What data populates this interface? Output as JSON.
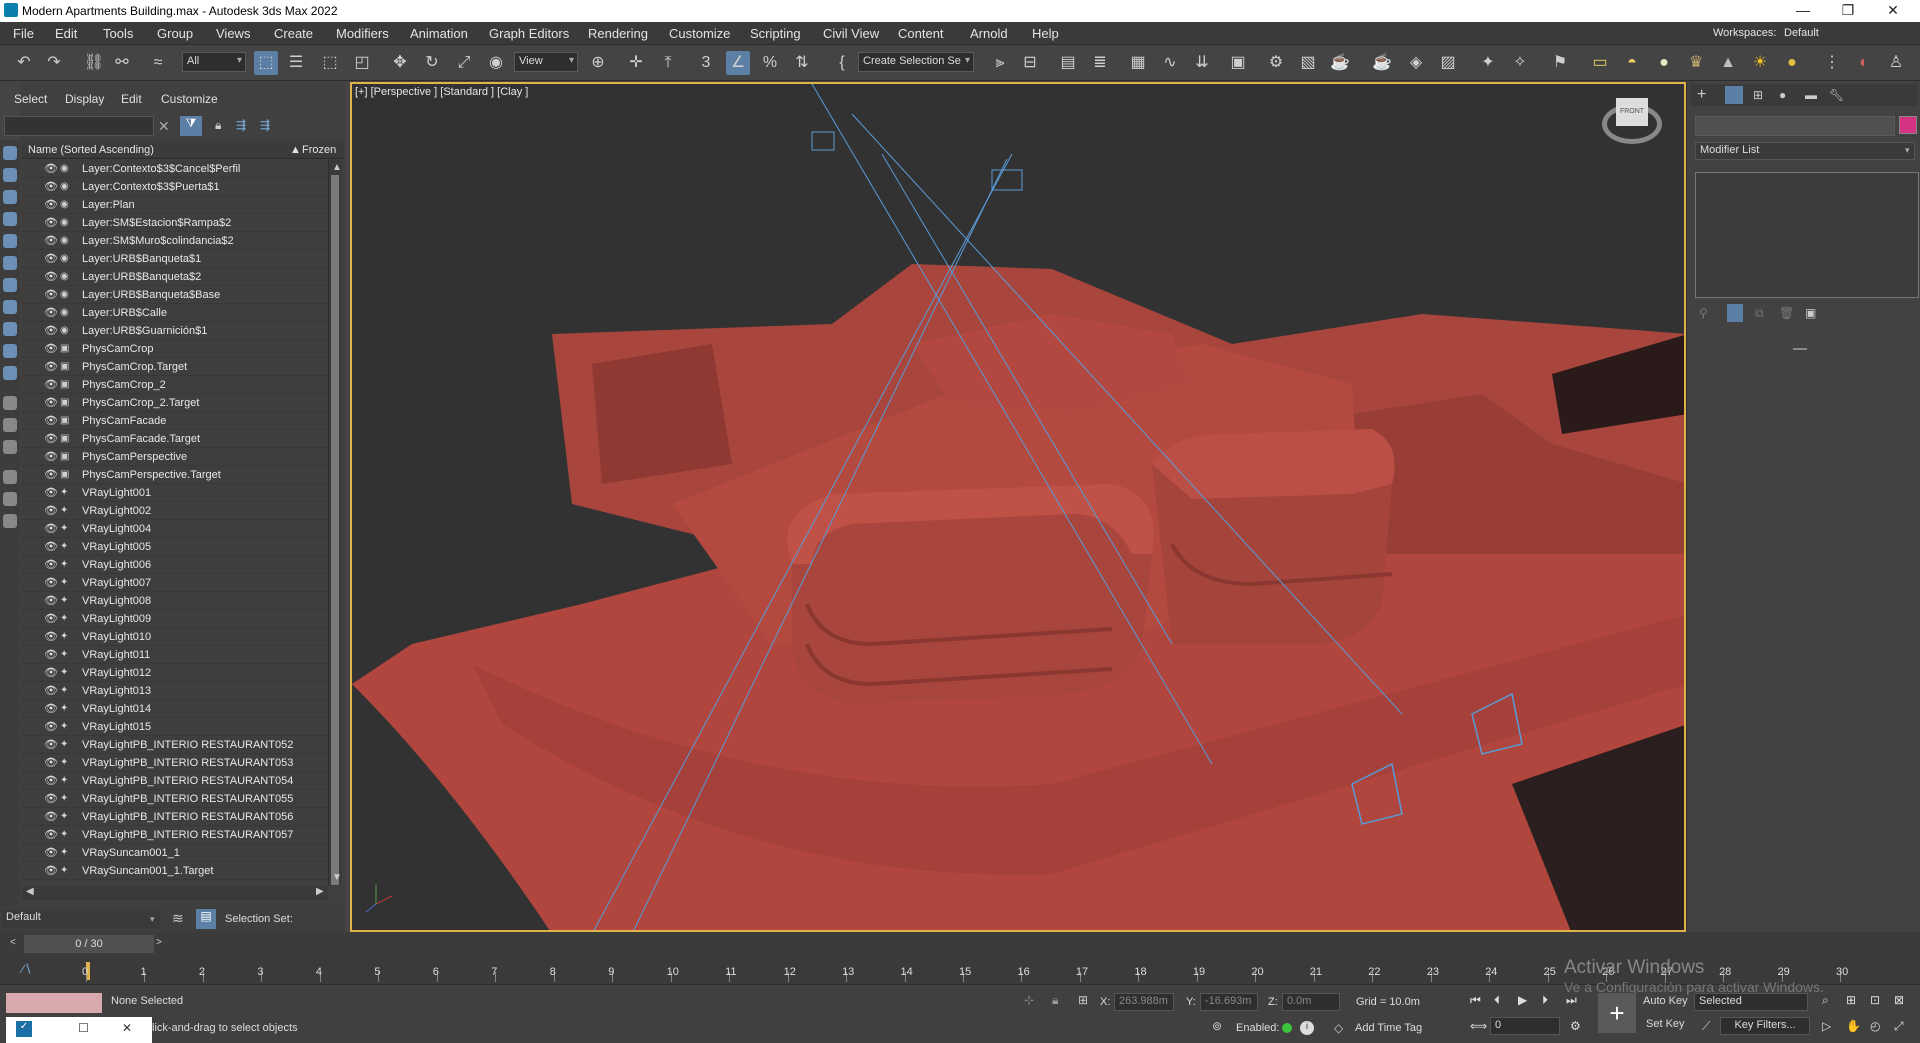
{
  "window": {
    "title": "Modern Apartments Building.max - Autodesk 3ds Max 2022",
    "minimize": "—",
    "maximize": "❐",
    "close": "✕"
  },
  "menu": [
    "File",
    "Edit",
    "Tools",
    "Group",
    "Views",
    "Create",
    "Modifiers",
    "Animation",
    "Graph Editors",
    "Rendering",
    "Customize",
    "Scripting",
    "Civil View",
    "Content",
    "Arnold",
    "Help"
  ],
  "workspace": {
    "label": "Workspaces:",
    "value": "Default"
  },
  "toolbar": {
    "filter_value": "All",
    "view_value": "View",
    "selection_set": "Create Selection Se"
  },
  "explorer": {
    "menu": [
      "Select",
      "Display",
      "Edit",
      "Customize"
    ],
    "col_name": "Name (Sorted Ascending)",
    "col_frozen": "Frozen",
    "rows": [
      {
        "name": "Layer:Contexto$3$Cancel$Perfil",
        "type": "layer"
      },
      {
        "name": "Layer:Contexto$3$Puerta$1",
        "type": "layer"
      },
      {
        "name": "Layer:Plan",
        "type": "layer"
      },
      {
        "name": "Layer:SM$Estacion$Rampa$2",
        "type": "layer"
      },
      {
        "name": "Layer:SM$Muro$colindancia$2",
        "type": "layer"
      },
      {
        "name": "Layer:URB$Banqueta$1",
        "type": "layer"
      },
      {
        "name": "Layer:URB$Banqueta$2",
        "type": "layer"
      },
      {
        "name": "Layer:URB$Banqueta$Base",
        "type": "layer"
      },
      {
        "name": "Layer:URB$Calle",
        "type": "layer"
      },
      {
        "name": "Layer:URB$Guarnición$1",
        "type": "layer"
      },
      {
        "name": "PhysCamCrop",
        "type": "camera"
      },
      {
        "name": "PhysCamCrop.Target",
        "type": "camera"
      },
      {
        "name": "PhysCamCrop_2",
        "type": "camera"
      },
      {
        "name": "PhysCamCrop_2.Target",
        "type": "camera"
      },
      {
        "name": "PhysCamFacade",
        "type": "camera"
      },
      {
        "name": "PhysCamFacade.Target",
        "type": "camera"
      },
      {
        "name": "PhysCamPerspective",
        "type": "camera"
      },
      {
        "name": "PhysCamPerspective.Target",
        "type": "camera"
      },
      {
        "name": "VRayLight001",
        "type": "light"
      },
      {
        "name": "VRayLight002",
        "type": "light"
      },
      {
        "name": "VRayLight004",
        "type": "light"
      },
      {
        "name": "VRayLight005",
        "type": "light"
      },
      {
        "name": "VRayLight006",
        "type": "light"
      },
      {
        "name": "VRayLight007",
        "type": "light"
      },
      {
        "name": "VRayLight008",
        "type": "light"
      },
      {
        "name": "VRayLight009",
        "type": "light"
      },
      {
        "name": "VRayLight010",
        "type": "light"
      },
      {
        "name": "VRayLight011",
        "type": "light"
      },
      {
        "name": "VRayLight012",
        "type": "light"
      },
      {
        "name": "VRayLight013",
        "type": "light"
      },
      {
        "name": "VRayLight014",
        "type": "light"
      },
      {
        "name": "VRayLight015",
        "type": "light"
      },
      {
        "name": "VRayLightPB_INTERIO RESTAURANT052",
        "type": "light"
      },
      {
        "name": "VRayLightPB_INTERIO RESTAURANT053",
        "type": "light"
      },
      {
        "name": "VRayLightPB_INTERIO RESTAURANT054",
        "type": "light"
      },
      {
        "name": "VRayLightPB_INTERIO RESTAURANT055",
        "type": "light"
      },
      {
        "name": "VRayLightPB_INTERIO RESTAURANT056",
        "type": "light"
      },
      {
        "name": "VRayLightPB_INTERIO RESTAURANT057",
        "type": "light"
      },
      {
        "name": "VRaySuncam001_1",
        "type": "light"
      },
      {
        "name": "VRaySuncam001_1.Target",
        "type": "light"
      }
    ],
    "layer_value": "Default",
    "selection_set_label": "Selection Set:"
  },
  "viewport": {
    "label": "[+] [Perspective ] [Standard ] [Clay ]",
    "viewcube": "FRONT"
  },
  "command_panel": {
    "modifier_list": "Modifier List",
    "color": "#d63384"
  },
  "timeline": {
    "frame": "0 / 30",
    "ticks": [
      0,
      1,
      2,
      3,
      4,
      5,
      6,
      7,
      8,
      9,
      10,
      11,
      12,
      13,
      14,
      15,
      16,
      17,
      18,
      19,
      20,
      21,
      22,
      23,
      24,
      25,
      26,
      27,
      28,
      29,
      30
    ]
  },
  "status": {
    "none_selected": "None Selected",
    "prompt": "lick-and-drag to select objects",
    "x_label": "X:",
    "x_value": "263.988m",
    "y_label": "Y:",
    "y_value": "-16.693m",
    "z_label": "Z:",
    "z_value": "0.0m",
    "grid": "Grid = 10.0m",
    "enabled": "Enabled:",
    "add_time_tag": "Add Time Tag",
    "auto_key": "Auto Key",
    "set_key": "Set Key",
    "selected": "Selected",
    "key_filters": "Key Filters...",
    "frame_value": "0",
    "activate_title": "Activar Windows",
    "activate_sub": "Ve a Configuración para activar Windows."
  }
}
